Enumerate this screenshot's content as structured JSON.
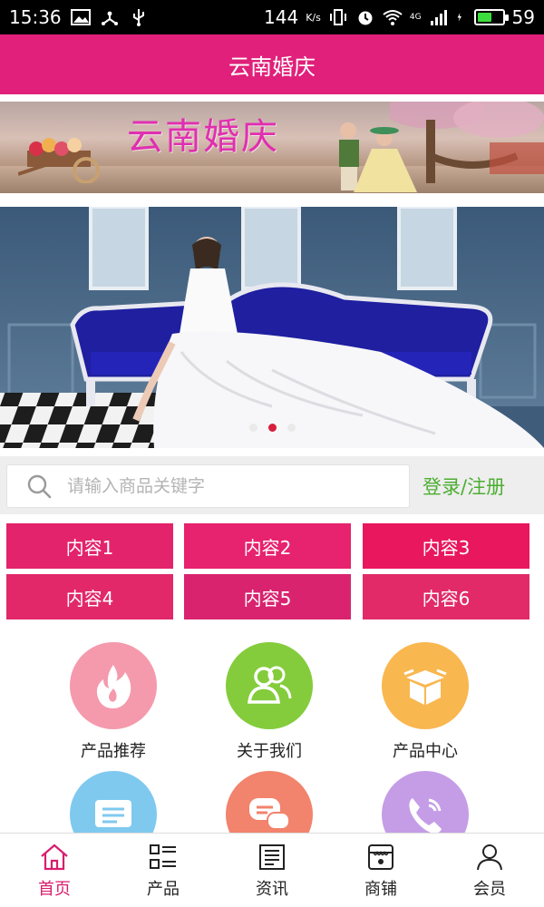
{
  "status_bar": {
    "time": "15:36",
    "speed": "144",
    "speed_unit": "K/s",
    "network": "4G",
    "battery": "59",
    "battery_level": 0.59
  },
  "header": {
    "title": "云南婚庆"
  },
  "banner": {
    "overlay_text": "云南婚庆",
    "slide_count": 3,
    "active_slide": 2
  },
  "search": {
    "placeholder": "请输入商品关键字",
    "login_label": "登录/注册"
  },
  "content_buttons": [
    {
      "label": "内容1"
    },
    {
      "label": "内容2"
    },
    {
      "label": "内容3"
    },
    {
      "label": "内容4"
    },
    {
      "label": "内容5"
    },
    {
      "label": "内容6"
    }
  ],
  "menu": [
    {
      "label": "产品推荐",
      "icon": "fire-icon",
      "color": "#f49aac"
    },
    {
      "label": "关于我们",
      "icon": "users-icon",
      "color": "#84cc3c"
    },
    {
      "label": "产品中心",
      "icon": "box-icon",
      "color": "#f9b750"
    },
    {
      "label": "",
      "icon": "message-icon",
      "color": "#7fc9ef"
    },
    {
      "label": "",
      "icon": "chat-icon",
      "color": "#f2836c"
    },
    {
      "label": "",
      "icon": "phone-icon",
      "color": "#c59de6"
    }
  ],
  "bottom_nav": [
    {
      "label": "首页",
      "icon": "home-icon",
      "active": true
    },
    {
      "label": "产品",
      "icon": "grid-list-icon",
      "active": false
    },
    {
      "label": "资讯",
      "icon": "news-icon",
      "active": false
    },
    {
      "label": "商铺",
      "icon": "shop-icon",
      "active": false
    },
    {
      "label": "会员",
      "icon": "user-icon",
      "active": false
    }
  ],
  "colors": {
    "brand": "#e0207a",
    "button": "#e3236c",
    "login": "#4cae31",
    "nav_active": "#d81e6e"
  }
}
